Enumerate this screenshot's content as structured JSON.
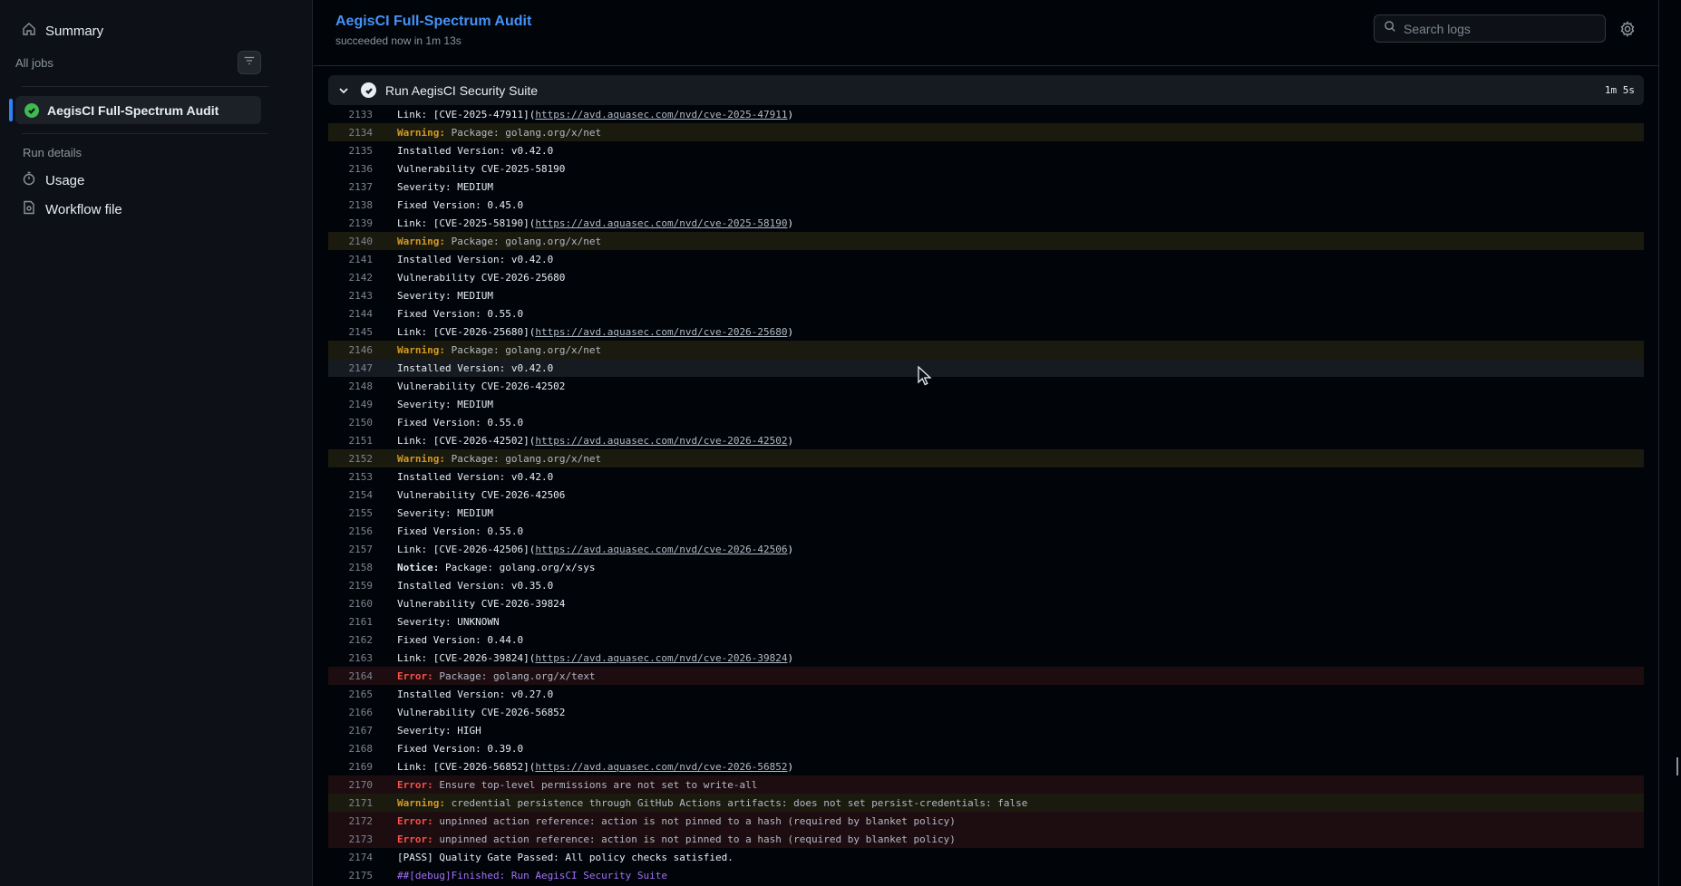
{
  "sidebar": {
    "summary_label": "Summary",
    "all_jobs_label": "All jobs",
    "job_label": "AegisCI Full-Spectrum Audit",
    "run_details_label": "Run details",
    "usage_label": "Usage",
    "workflow_file_label": "Workflow file"
  },
  "header": {
    "title": "AegisCI Full-Spectrum Audit",
    "subtitle": "succeeded now in 1m 13s",
    "search_placeholder": "Search logs"
  },
  "step": {
    "title": "Run AegisCI Security Suite",
    "duration": "1m 5s"
  },
  "log_lines": [
    {
      "n": "2133",
      "type": "plain",
      "text": "Link: [CVE-2025-47911](",
      "link": "https://avd.aquasec.com/nvd/cve-2025-47911",
      "after": ")"
    },
    {
      "n": "2134",
      "type": "warn",
      "level": "Warning:",
      "text": " Package: golang.org/x/net"
    },
    {
      "n": "2135",
      "type": "plain",
      "text": "Installed Version: v0.42.0"
    },
    {
      "n": "2136",
      "type": "plain",
      "text": "Vulnerability CVE-2025-58190"
    },
    {
      "n": "2137",
      "type": "plain",
      "text": "Severity: MEDIUM"
    },
    {
      "n": "2138",
      "type": "plain",
      "text": "Fixed Version: 0.45.0"
    },
    {
      "n": "2139",
      "type": "plain",
      "text": "Link: [CVE-2025-58190](",
      "link": "https://avd.aquasec.com/nvd/cve-2025-58190",
      "after": ")"
    },
    {
      "n": "2140",
      "type": "warn",
      "level": "Warning:",
      "text": " Package: golang.org/x/net"
    },
    {
      "n": "2141",
      "type": "plain",
      "text": "Installed Version: v0.42.0"
    },
    {
      "n": "2142",
      "type": "plain",
      "text": "Vulnerability CVE-2026-25680"
    },
    {
      "n": "2143",
      "type": "plain",
      "text": "Severity: MEDIUM"
    },
    {
      "n": "2144",
      "type": "plain",
      "text": "Fixed Version: 0.55.0"
    },
    {
      "n": "2145",
      "type": "plain",
      "text": "Link: [CVE-2026-25680](",
      "link": "https://avd.aquasec.com/nvd/cve-2026-25680",
      "after": ")"
    },
    {
      "n": "2146",
      "type": "warn",
      "level": "Warning:",
      "text": " Package: golang.org/x/net"
    },
    {
      "n": "2147",
      "type": "hover",
      "text": "Installed Version: v0.42.0"
    },
    {
      "n": "2148",
      "type": "plain",
      "text": "Vulnerability CVE-2026-42502"
    },
    {
      "n": "2149",
      "type": "plain",
      "text": "Severity: MEDIUM"
    },
    {
      "n": "2150",
      "type": "plain",
      "text": "Fixed Version: 0.55.0"
    },
    {
      "n": "2151",
      "type": "plain",
      "text": "Link: [CVE-2026-42502](",
      "link": "https://avd.aquasec.com/nvd/cve-2026-42502",
      "after": ")"
    },
    {
      "n": "2152",
      "type": "warn",
      "level": "Warning:",
      "text": " Package: golang.org/x/net"
    },
    {
      "n": "2153",
      "type": "plain",
      "text": "Installed Version: v0.42.0"
    },
    {
      "n": "2154",
      "type": "plain",
      "text": "Vulnerability CVE-2026-42506"
    },
    {
      "n": "2155",
      "type": "plain",
      "text": "Severity: MEDIUM"
    },
    {
      "n": "2156",
      "type": "plain",
      "text": "Fixed Version: 0.55.0"
    },
    {
      "n": "2157",
      "type": "plain",
      "text": "Link: [CVE-2026-42506](",
      "link": "https://avd.aquasec.com/nvd/cve-2026-42506",
      "after": ")"
    },
    {
      "n": "2158",
      "type": "notice",
      "level": "Notice:",
      "text": " Package: golang.org/x/sys"
    },
    {
      "n": "2159",
      "type": "plain",
      "text": "Installed Version: v0.35.0"
    },
    {
      "n": "2160",
      "type": "plain",
      "text": "Vulnerability CVE-2026-39824"
    },
    {
      "n": "2161",
      "type": "plain",
      "text": "Severity: UNKNOWN"
    },
    {
      "n": "2162",
      "type": "plain",
      "text": "Fixed Version: 0.44.0"
    },
    {
      "n": "2163",
      "type": "plain",
      "text": "Link: [CVE-2026-39824](",
      "link": "https://avd.aquasec.com/nvd/cve-2026-39824",
      "after": ")"
    },
    {
      "n": "2164",
      "type": "err",
      "level": "Error:",
      "text": " Package: golang.org/x/text"
    },
    {
      "n": "2165",
      "type": "plain",
      "text": "Installed Version: v0.27.0"
    },
    {
      "n": "2166",
      "type": "plain",
      "text": "Vulnerability CVE-2026-56852"
    },
    {
      "n": "2167",
      "type": "plain",
      "text": "Severity: HIGH"
    },
    {
      "n": "2168",
      "type": "plain",
      "text": "Fixed Version: 0.39.0"
    },
    {
      "n": "2169",
      "type": "plain",
      "text": "Link: [CVE-2026-56852](",
      "link": "https://avd.aquasec.com/nvd/cve-2026-56852",
      "after": ")"
    },
    {
      "n": "2170",
      "type": "err",
      "level": "Error:",
      "text": " Ensure top-level permissions are not set to write-all"
    },
    {
      "n": "2171",
      "type": "warn",
      "level": "Warning:",
      "text": " credential persistence through GitHub Actions artifacts: does not set persist-credentials: false"
    },
    {
      "n": "2172",
      "type": "err",
      "level": "Error:",
      "text": " unpinned action reference: action is not pinned to a hash (required by blanket policy)"
    },
    {
      "n": "2173",
      "type": "err",
      "level": "Error:",
      "text": " unpinned action reference: action is not pinned to a hash (required by blanket policy)"
    },
    {
      "n": "2174",
      "type": "plain",
      "text": "[PASS] Quality Gate Passed: All policy checks satisfied."
    },
    {
      "n": "2175",
      "type": "debug",
      "text": "##[debug]Finished: Run AegisCI Security Suite"
    }
  ]
}
